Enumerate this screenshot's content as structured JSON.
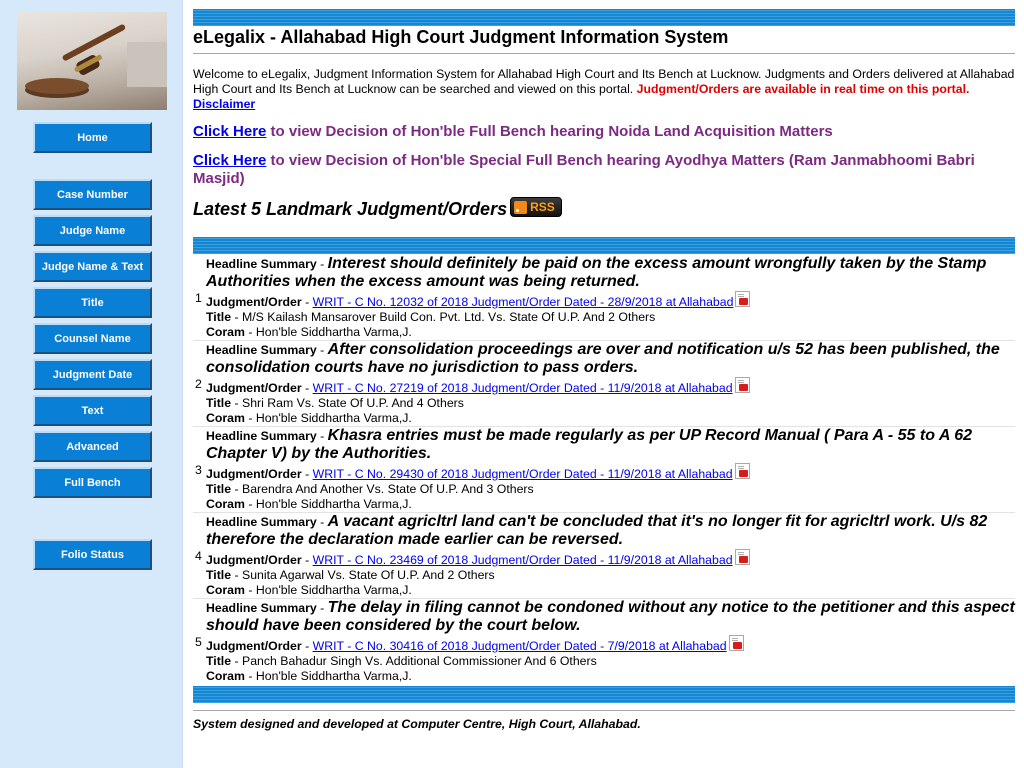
{
  "sidebar": {
    "logo_icon": "gavel-icon",
    "buttons": [
      {
        "label": "Home"
      },
      {
        "label": "Case Number"
      },
      {
        "label": "Judge Name"
      },
      {
        "label": "Judge Name & Text"
      },
      {
        "label": "Title"
      },
      {
        "label": "Counsel Name"
      },
      {
        "label": "Judgment Date"
      },
      {
        "label": "Text"
      },
      {
        "label": "Advanced"
      },
      {
        "label": "Full Bench"
      },
      {
        "label": "Folio Status"
      }
    ]
  },
  "header": {
    "title": "eLegalix - Allahabad High Court Judgment Information System"
  },
  "welcome": {
    "text": "Welcome to eLegalix, Judgment Information System for Allahabad High Court and Its Bench at Lucknow. Judgments and Orders delivered at Allahabad High Court and Its Bench at Lucknow can be searched and viewed on this portal.",
    "realtime": "Judgment/Orders are available in real time on this portal.",
    "disclaimer": "Disclaimer"
  },
  "notices": [
    {
      "link": "Click Here",
      "text": "to view Decision of Hon'ble Full Bench hearing Noida Land Acquisition Matters"
    },
    {
      "link": "Click Here",
      "text": "to view Decision of Hon'ble Special Full Bench hearing Ayodhya Matters (Ram Janmabhoomi Babri Masjid)"
    }
  ],
  "landmark": {
    "heading": "Latest 5 Landmark Judgment/Orders",
    "rss_label": "RSS",
    "rss_icon": "rss-feed-icon"
  },
  "labels": {
    "headline": "Headline Summary",
    "judgment": "Judgment/Order",
    "title": "Title",
    "coram": "Coram",
    "sep": " - "
  },
  "judgments": [
    {
      "num": "1",
      "headline": "Interest should definitely be paid on the excess amount wrongfully taken by the Stamp Authorities when the excess amount was being returned.",
      "link": "WRIT - C No. 12032 of 2018 Judgment/Order Dated - 28/9/2018 at Allahabad",
      "title": "M/S Kailash Mansarover Build Con. Pvt. Ltd. Vs. State Of U.P. And 2 Others",
      "coram": "Hon'ble Siddhartha Varma,J."
    },
    {
      "num": "2",
      "headline": "After consolidation proceedings are over and notification u/s 52 has been published, the consolidation courts have no jurisdiction to pass orders.",
      "link": "WRIT - C No. 27219 of 2018 Judgment/Order Dated - 11/9/2018 at Allahabad",
      "title": "Shri Ram Vs. State Of U.P. And 4 Others",
      "coram": "Hon'ble Siddhartha Varma,J."
    },
    {
      "num": "3",
      "headline": "Khasra entries must be made regularly as per UP Record Manual ( Para A - 55 to A 62 Chapter V) by the Authorities.",
      "link": "WRIT - C No. 29430 of 2018 Judgment/Order Dated - 11/9/2018 at Allahabad",
      "title": "Barendra And Another Vs. State Of U.P. And 3 Others",
      "coram": "Hon'ble Siddhartha Varma,J."
    },
    {
      "num": "4",
      "headline": "A vacant agricltrl land can't be concluded that it's no longer fit for agricltrl work. U/s 82 therefore the declaration made earlier can be reversed.",
      "link": "WRIT - C No. 23469 of 2018 Judgment/Order Dated - 11/9/2018 at Allahabad",
      "title": "Sunita Agarwal Vs. State Of U.P. And 2 Others",
      "coram": "Hon'ble Siddhartha Varma,J."
    },
    {
      "num": "5",
      "headline": "The delay in filing cannot be condoned without any notice to the petitioner and this aspect should have been considered by the court below.",
      "link": "WRIT - C No. 30416 of 2018 Judgment/Order Dated - 7/9/2018 at Allahabad",
      "title": "Panch Bahadur Singh Vs. Additional Commissioner And 6 Others",
      "coram": "Hon'ble Siddhartha Varma,J."
    }
  ],
  "footer": {
    "text": "System designed and developed at Computer Centre, High Court, Allahabad."
  },
  "colors": {
    "sidebar_bg": "#d6e9fb",
    "nav_button": "#0a7fd6",
    "bar_blue": "#1488d4",
    "notice_purple": "#7d2a82",
    "alert_red": "#e00000"
  }
}
